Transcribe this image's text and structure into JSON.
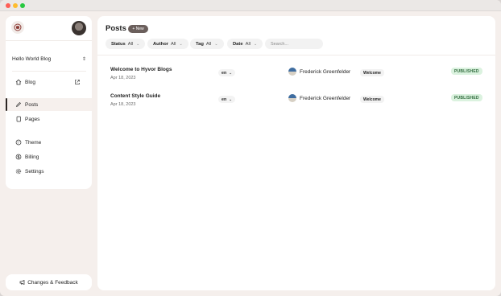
{
  "window": {
    "controls": [
      "close",
      "minimize",
      "maximize"
    ]
  },
  "sidebar": {
    "blog_name": "Hello World Blog",
    "items": [
      {
        "label": "Blog",
        "icon": "home-icon"
      },
      {
        "label": "Posts",
        "icon": "pen-icon",
        "active": true
      },
      {
        "label": "Pages",
        "icon": "page-icon"
      },
      {
        "label": "Theme",
        "icon": "palette-icon"
      },
      {
        "label": "Billing",
        "icon": "dollar-icon"
      },
      {
        "label": "Settings",
        "icon": "gear-icon"
      }
    ],
    "feedback_label": "Changes & Feedback"
  },
  "main": {
    "title": "Posts",
    "new_button": "+ New",
    "filters": [
      {
        "label": "Status",
        "value": "All"
      },
      {
        "label": "Author",
        "value": "All"
      },
      {
        "label": "Tag",
        "value": "All"
      },
      {
        "label": "Date",
        "value": "All"
      }
    ],
    "search": {
      "placeholder": "Search..."
    },
    "posts": [
      {
        "title": "Welcome to Hyvor Blogs",
        "date": "Apr 18, 2023",
        "language": "en",
        "author": "Frederick Greenfelder",
        "tag": "Welcome",
        "status": "PUBLISHED"
      },
      {
        "title": "Content Style Guide",
        "date": "Apr 18, 2023",
        "language": "en",
        "author": "Frederick Greenfelder",
        "tag": "Welcome",
        "status": "PUBLISHED"
      }
    ]
  },
  "colors": {
    "background": "#f5efec",
    "accent": "#6b5f5c",
    "status_bg": "#dbf2df",
    "status_text": "#2e6a3b"
  }
}
